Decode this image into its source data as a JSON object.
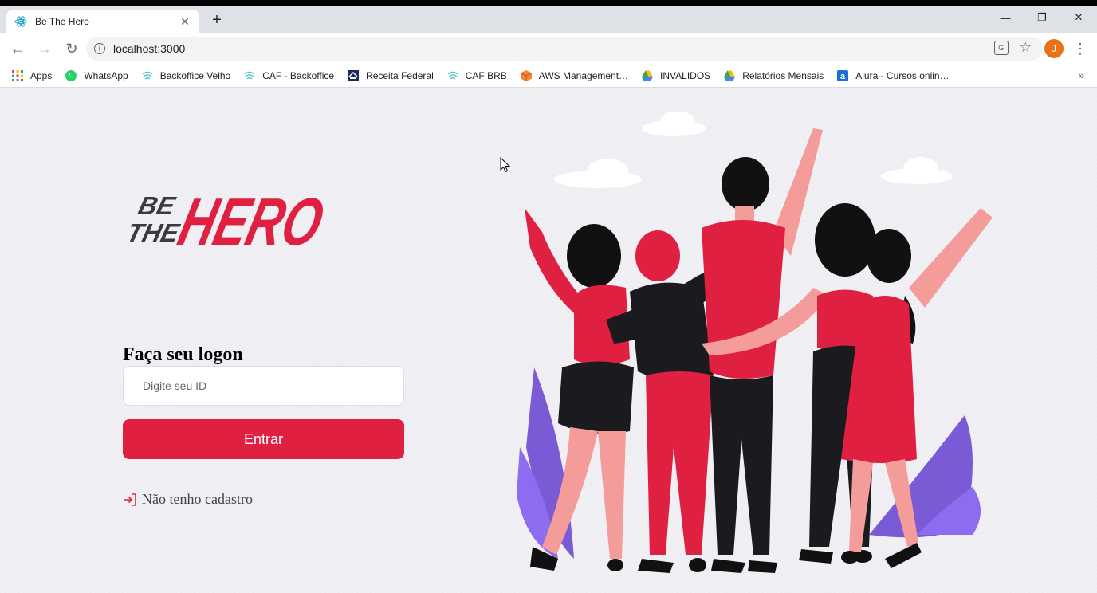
{
  "browser": {
    "tab_title": "Be The Hero",
    "url": "localhost:3000",
    "profile_initial": "J",
    "bookmarks": [
      {
        "label": "Apps",
        "icon": "apps-grid-icon"
      },
      {
        "label": "WhatsApp",
        "icon": "whatsapp-icon"
      },
      {
        "label": "Backoffice Velho",
        "icon": "caf-icon"
      },
      {
        "label": "CAF - Backoffice",
        "icon": "caf-icon"
      },
      {
        "label": "Receita Federal",
        "icon": "receita-icon"
      },
      {
        "label": "CAF BRB",
        "icon": "caf-icon"
      },
      {
        "label": "AWS Management…",
        "icon": "aws-icon"
      },
      {
        "label": "INVALIDOS",
        "icon": "drive-icon"
      },
      {
        "label": "Relatórios Mensais",
        "icon": "drive-icon"
      },
      {
        "label": "Alura - Cursos onlin…",
        "icon": "alura-icon"
      }
    ]
  },
  "logo": {
    "line1": "BE",
    "line2": "THE",
    "word": "HERO"
  },
  "login": {
    "title": "Faça seu logon",
    "id_placeholder": "Digite seu ID",
    "submit_label": "Entrar",
    "register_link": "Não tenho cadastro"
  },
  "colors": {
    "accent": "#e02041",
    "text": "#41414d"
  }
}
